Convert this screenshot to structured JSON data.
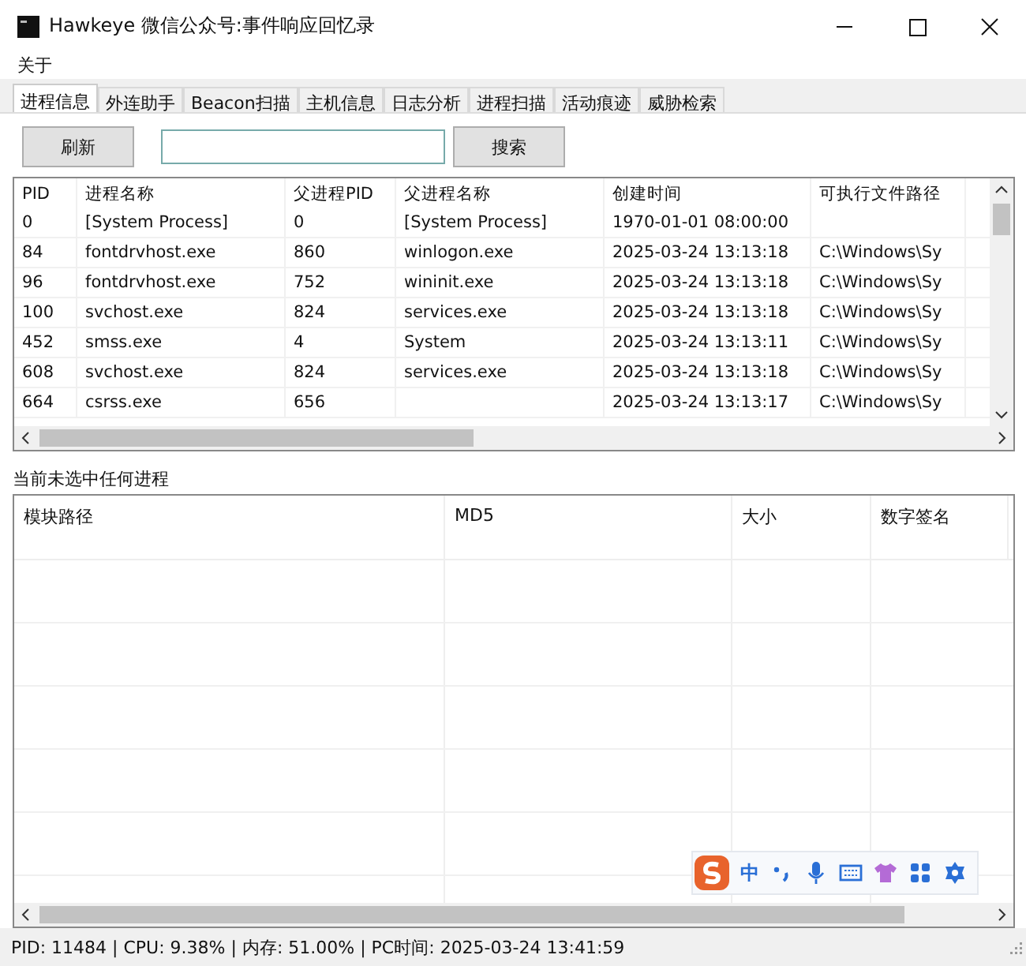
{
  "window": {
    "title": "Hawkeye 微信公众号:事件响应回忆录"
  },
  "menu": [
    "关于"
  ],
  "tabs": [
    {
      "label": "进程信息",
      "selected": true
    },
    {
      "label": "外连助手",
      "selected": false
    },
    {
      "label": "Beacon扫描",
      "selected": false
    },
    {
      "label": "主机信息",
      "selected": false
    },
    {
      "label": "日志分析",
      "selected": false
    },
    {
      "label": "进程扫描",
      "selected": false
    },
    {
      "label": "活动痕迹",
      "selected": false
    },
    {
      "label": "威胁检索",
      "selected": false
    }
  ],
  "toolbar": {
    "refresh_button": "刷新",
    "search_button": "搜索"
  },
  "process_table": {
    "columns": [
      "PID",
      "进程名称",
      "父进程PID",
      "父进程名称",
      "创建时间",
      "可执行文件路径"
    ],
    "rows": [
      [
        "0",
        "[System Process]",
        "0",
        "[System Process]",
        "1970-01-01 08:00:00",
        ""
      ],
      [
        "84",
        "fontdrvhost.exe",
        "860",
        "winlogon.exe",
        "2025-03-24 13:13:18",
        "C:\\Windows\\Sy"
      ],
      [
        "96",
        "fontdrvhost.exe",
        "752",
        "wininit.exe",
        "2025-03-24 13:13:18",
        "C:\\Windows\\Sy"
      ],
      [
        "100",
        "svchost.exe",
        "824",
        "services.exe",
        "2025-03-24 13:13:18",
        "C:\\Windows\\Sy"
      ],
      [
        "452",
        "smss.exe",
        "4",
        "System",
        "2025-03-24 13:13:11",
        "C:\\Windows\\Sy"
      ],
      [
        "608",
        "svchost.exe",
        "824",
        "services.exe",
        "2025-03-24 13:13:18",
        "C:\\Windows\\Sy"
      ],
      [
        "664",
        "csrss.exe",
        "656",
        "",
        "2025-03-24 13:13:17",
        "C:\\Windows\\Sy"
      ]
    ]
  },
  "selection_label": "当前未选中任何进程",
  "module_table": {
    "columns": [
      "模块路径",
      "MD5",
      "大小",
      "数字签名"
    ]
  },
  "ime_toolbar": {
    "mode": "中"
  },
  "status_bar": "PID: 11484 | CPU: 9.38% | 内存: 51.00% | PC时间: 2025-03-24 13:41:59"
}
